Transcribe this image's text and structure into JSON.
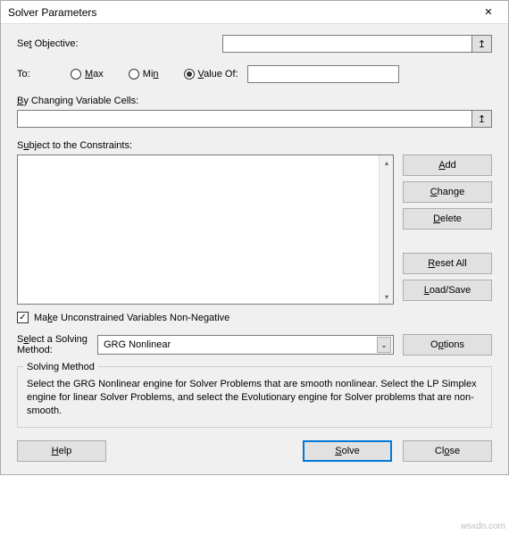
{
  "title": "Solver Parameters",
  "labels": {
    "set_objective_pre": "Se",
    "set_objective_und": "t",
    "set_objective_post": " Objective:",
    "to": "To:",
    "max_und": "M",
    "max_post": "ax",
    "min_pre": "Mi",
    "min_und": "n",
    "value_und": "V",
    "value_post": "alue Of:",
    "by_und": "B",
    "by_post": "y Changing Variable Cells:",
    "subject_pre": "S",
    "subject_und": "u",
    "subject_post": "bject to the Constraints:",
    "chk_pre": "Ma",
    "chk_und": "k",
    "chk_post": "e Unconstrained Variables Non-Negative",
    "method_pre": "S",
    "method_und": "e",
    "method_post": "lect a Solving Method:"
  },
  "inputs": {
    "objective": "",
    "value_of": "",
    "variable_cells": ""
  },
  "radios": {
    "selected": "value"
  },
  "constraints": [],
  "buttons": {
    "add_und": "A",
    "add_post": "dd",
    "change_und": "C",
    "change_post": "hange",
    "delete_und": "D",
    "delete_post": "elete",
    "reset_und": "R",
    "reset_post": "eset All",
    "load_und": "L",
    "load_post": "oad/Save",
    "options_pre": "O",
    "options_und": "p",
    "options_post": "tions",
    "help_und": "H",
    "help_post": "elp",
    "solve_und": "S",
    "solve_post": "olve",
    "close_pre": "Cl",
    "close_und": "o",
    "close_post": "se"
  },
  "checkbox_checked": "✓",
  "method": {
    "selected": "GRG Nonlinear"
  },
  "groupbox": {
    "title": "Solving Method",
    "text": "Select the GRG Nonlinear engine for Solver Problems that are smooth nonlinear. Select the LP Simplex engine for linear Solver Problems, and select the Evolutionary engine for Solver problems that are non-smooth."
  },
  "icons": {
    "ref_arrow": "↥",
    "dropdown": "⌄",
    "scroll_up": "▴",
    "scroll_down": "▾",
    "close_x": "✕"
  },
  "watermark": "wsxdn.com"
}
